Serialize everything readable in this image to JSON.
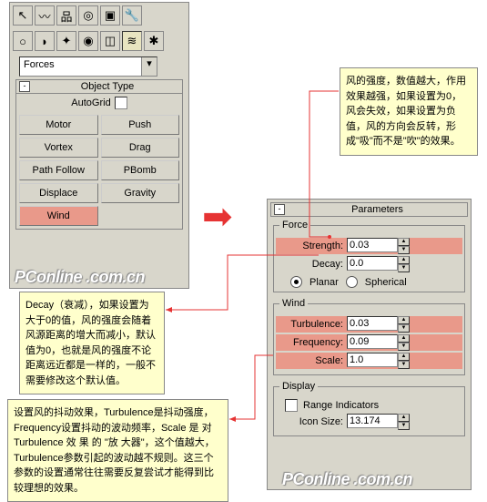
{
  "forces_panel": {
    "dropdown": "Forces",
    "object_type_title": "Object Type",
    "autogrid": "AutoGrid",
    "buttons": [
      "Motor",
      "Push",
      "Vortex",
      "Drag",
      "Path Follow",
      "PBomb",
      "Displace",
      "Gravity",
      "Wind"
    ]
  },
  "param_panel": {
    "title": "Parameters",
    "force": {
      "legend": "Force",
      "strength_label": "Strength:",
      "strength_val": "0.03",
      "decay_label": "Decay:",
      "decay_val": "0.0",
      "planar": "Planar",
      "spherical": "Spherical"
    },
    "wind": {
      "legend": "Wind",
      "turb_label": "Turbulence:",
      "turb_val": "0.03",
      "freq_label": "Frequency:",
      "freq_val": "0.09",
      "scale_label": "Scale:",
      "scale_val": "1.0"
    },
    "display": {
      "legend": "Display",
      "range": "Range Indicators",
      "icon_label": "Icon Size:",
      "icon_val": "13.174"
    }
  },
  "annotations": {
    "strength": "风的强度，数值越大，作用效果越强，如果设置为0，风会失效，如果设置为负值，风的方向会反转，形成\"吸\"而不是\"吹\"的效果。",
    "decay": "Decay（衰减），如果设置为大于0的值，风的强度会随着风源距离的增大而减小，默认值为0，也就是风的强度不论距离远近都是一样的，一般不需要修改这个默认值。",
    "wind": "设置风的抖动效果，Turbulence是抖动强度，Frequency设置抖动的波动频率，Scale 是 对 Turbulence 效 果 的 \"放 大器\"，这个值越大，Turbulence参数引起的波动越不规则。这三个参数的设置通常往往需要反复尝试才能得到比较理想的效果。"
  },
  "watermark1": "PConline .com.cn",
  "watermark2": "PConline .com.cn"
}
